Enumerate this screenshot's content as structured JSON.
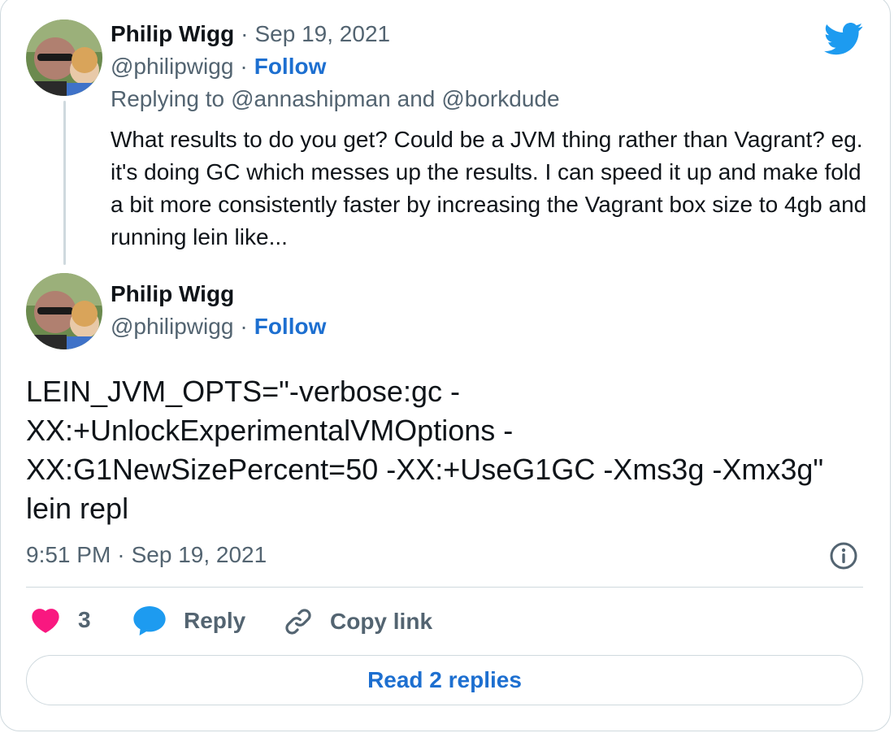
{
  "reply_tweet": {
    "author_name": "Philip Wigg",
    "separator": "·",
    "date": "Sep 19, 2021",
    "handle": "@philipwigg",
    "follow_label": "Follow",
    "replying_prefix": "Replying to",
    "replying_user_1": "@annashipman",
    "replying_and": "and",
    "replying_user_2": "@borkdude",
    "text": "What results to do you get? Could be a JVM thing rather than Vagrant? eg. it's doing GC which messes up the results. I can speed it up and make fold a bit more consistently faster by increasing the Vagrant box size to 4gb and running lein like..."
  },
  "main_tweet": {
    "author_name": "Philip Wigg",
    "handle": "@philipwigg",
    "separator": "·",
    "follow_label": "Follow",
    "text": "LEIN_JVM_OPTS=\"-verbose:gc -XX:+UnlockExperimentalVMOptions -XX:G1NewSizePercent=50 -XX:+UseG1GC -Xms3g -Xmx3g\" lein repl",
    "time": "9:51 PM",
    "date": "Sep 19, 2021"
  },
  "actions": {
    "like_count": "3",
    "reply_label": "Reply",
    "copy_link_label": "Copy link"
  },
  "read_replies_label": "Read 2 replies",
  "icons": {
    "brand": "twitter-bird-icon",
    "like": "heart-icon",
    "reply": "speech-bubble-icon",
    "copy": "link-icon",
    "info": "info-icon"
  },
  "colors": {
    "twitter_blue": "#1d9bf0",
    "link_blue": "#1d6fd0",
    "heart": "#f91880",
    "text": "#0f1419",
    "muted": "#536471",
    "border": "#cfd9de"
  }
}
